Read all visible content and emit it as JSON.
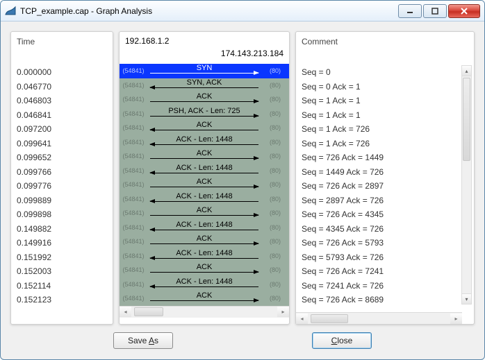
{
  "window": {
    "title": "TCP_example.cap - Graph Analysis"
  },
  "panes": {
    "time": {
      "header": "Time",
      "rows": [
        "0.000000",
        "0.046770",
        "0.046803",
        "0.046841",
        "0.097200",
        "0.099641",
        "0.099652",
        "0.099766",
        "0.099776",
        "0.099889",
        "0.099898",
        "0.149882",
        "0.149916",
        "0.151992",
        "0.152003",
        "0.152114",
        "0.152123"
      ]
    },
    "flow": {
      "endpoint_left": "192.168.1.2",
      "endpoint_right": "174.143.213.184",
      "left_port_dim": "(54841)",
      "right_port_dim": "(80)",
      "rows": [
        {
          "label": "SYN",
          "dir": "right",
          "selected": true
        },
        {
          "label": "SYN, ACK",
          "dir": "left"
        },
        {
          "label": "ACK",
          "dir": "right"
        },
        {
          "label": "PSH, ACK - Len: 725",
          "dir": "right"
        },
        {
          "label": "ACK",
          "dir": "left"
        },
        {
          "label": "ACK - Len: 1448",
          "dir": "left"
        },
        {
          "label": "ACK",
          "dir": "right"
        },
        {
          "label": "ACK - Len: 1448",
          "dir": "left"
        },
        {
          "label": "ACK",
          "dir": "right"
        },
        {
          "label": "ACK - Len: 1448",
          "dir": "left"
        },
        {
          "label": "ACK",
          "dir": "right"
        },
        {
          "label": "ACK - Len: 1448",
          "dir": "left"
        },
        {
          "label": "ACK",
          "dir": "right"
        },
        {
          "label": "ACK - Len: 1448",
          "dir": "left"
        },
        {
          "label": "ACK",
          "dir": "right"
        },
        {
          "label": "ACK - Len: 1448",
          "dir": "left"
        },
        {
          "label": "ACK",
          "dir": "right"
        }
      ]
    },
    "comment": {
      "header": "Comment",
      "rows": [
        "Seq = 0",
        "Seq = 0 Ack = 1",
        "Seq = 1 Ack = 1",
        "Seq = 1 Ack = 1",
        "Seq = 1 Ack = 726",
        "Seq = 1 Ack = 726",
        "Seq = 726 Ack = 1449",
        "Seq = 1449 Ack = 726",
        "Seq = 726 Ack = 2897",
        "Seq = 2897 Ack = 726",
        "Seq = 726 Ack = 4345",
        "Seq = 4345 Ack = 726",
        "Seq = 726 Ack = 5793",
        "Seq = 5793 Ack = 726",
        "Seq = 726 Ack = 7241",
        "Seq = 7241 Ack = 726",
        "Seq = 726 Ack = 8689"
      ]
    }
  },
  "buttons": {
    "save_as": {
      "pre": "Save ",
      "key": "A",
      "post": "s"
    },
    "close": {
      "key": "C",
      "post": "lose"
    }
  }
}
